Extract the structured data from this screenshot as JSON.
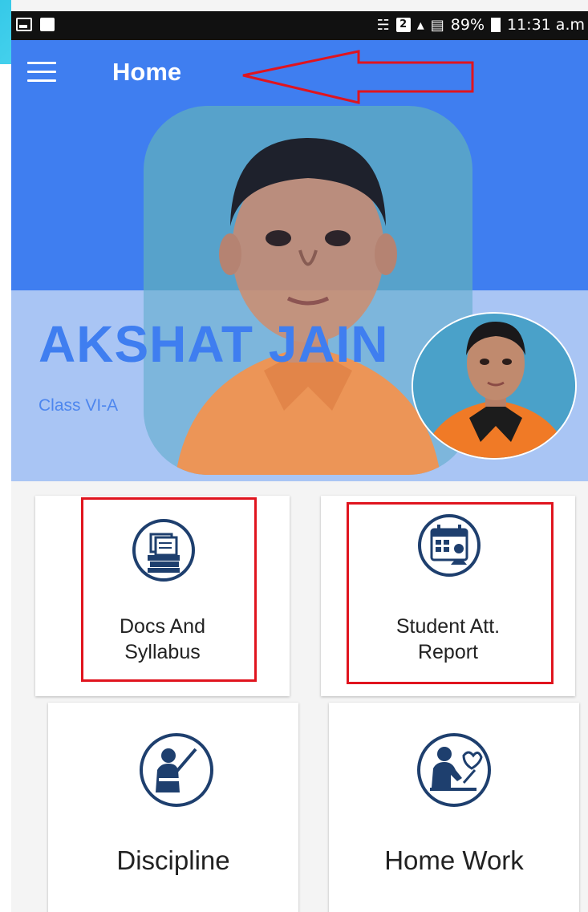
{
  "status_bar": {
    "battery": "89%",
    "time": "11:31 a.m",
    "sim_slot": "2"
  },
  "app_bar": {
    "title": "Home",
    "menu_icon": "hamburger-menu-icon"
  },
  "profile": {
    "name": "AKSHAT JAIN",
    "class": "Class VI-A"
  },
  "tiles": [
    {
      "label_line1": "Docs And",
      "label_line2": "Syllabus",
      "icon": "books-icon"
    },
    {
      "label_line1": "Student Att.",
      "label_line2": "Report",
      "icon": "calendar-report-icon"
    },
    {
      "label": "Discipline",
      "icon": "teacher-pointer-icon"
    },
    {
      "label": "Home Work",
      "icon": "student-writing-icon"
    }
  ],
  "colors": {
    "primary": "#3f7ef0",
    "panel": "#a9c5f4",
    "icon_navy": "#1e3f6e",
    "annotation_red": "#e0141e"
  }
}
